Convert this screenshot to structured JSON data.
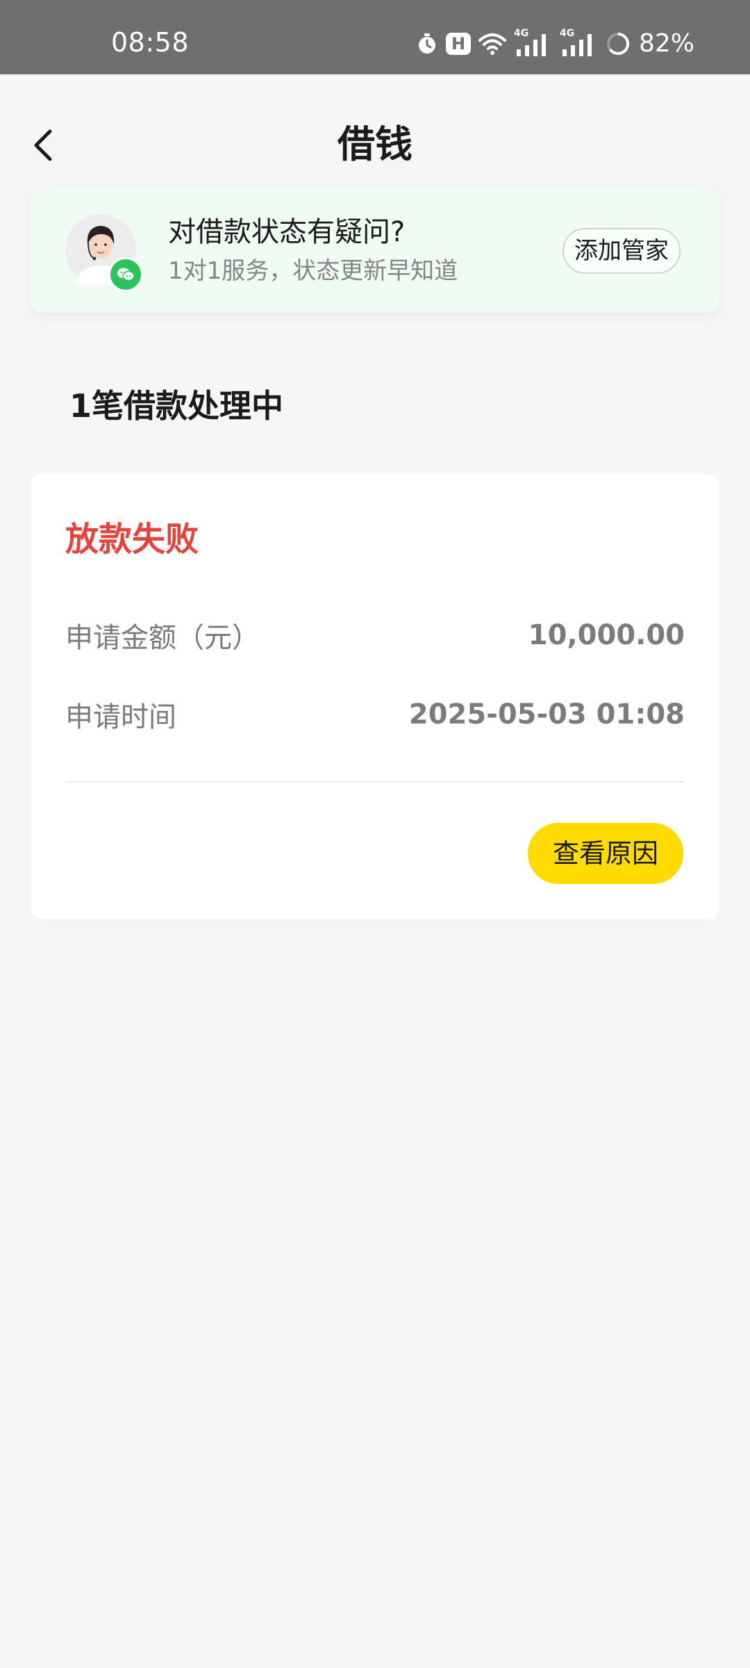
{
  "status_bar": {
    "time": "08:58",
    "hd_badge": "H",
    "signal_label_1": "4G",
    "signal_label_2": "4G",
    "battery": "82%",
    "icons": [
      "alarm-icon",
      "hd-icon",
      "wifi-icon",
      "signal-4g-icon",
      "signal-4g-icon",
      "battery-ring-icon"
    ]
  },
  "nav": {
    "title": "借钱",
    "back_icon": "chevron-left-icon"
  },
  "service_banner": {
    "title": "对借款状态有疑问?",
    "subtitle": "1对1服务，状态更新早知道",
    "button_label": "添加管家",
    "avatar_icon": "customer-service-avatar",
    "badge_icon": "wechat-icon"
  },
  "section": {
    "heading": "1笔借款处理中"
  },
  "loan_card": {
    "status": "放款失败",
    "amount_label": "申请金额（元）",
    "amount_value": "10,000.00",
    "time_label": "申请时间",
    "time_value": "2025-05-03 01:08",
    "button_label": "查看原因"
  },
  "colors": {
    "status_bar_bg": "#6f6f6f",
    "page_bg": "#f6f6f6",
    "banner_bg": "#effcf4",
    "failure_red": "#e5443c",
    "primary_yellow": "#ffdb00",
    "wechat_green": "#2ec35a"
  }
}
